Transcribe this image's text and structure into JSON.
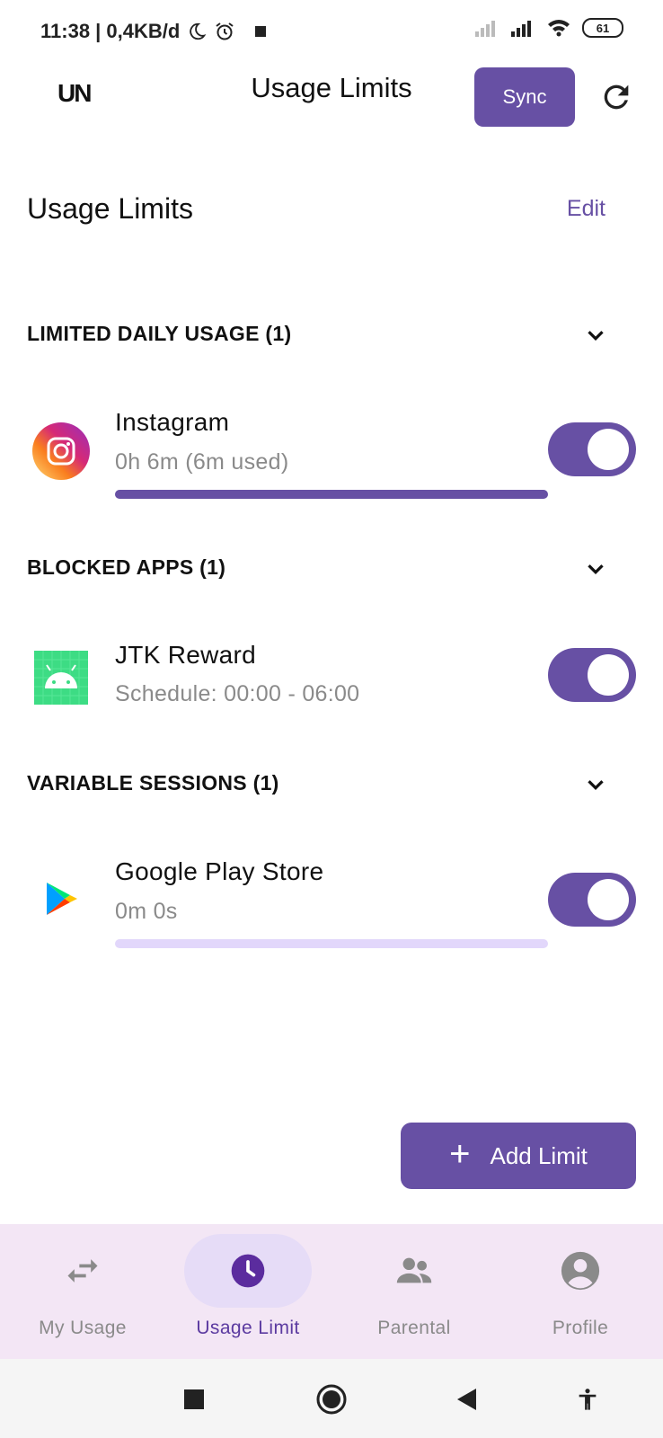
{
  "status_bar": {
    "time_info": "11:38 | 0,4KB/d",
    "battery": "61"
  },
  "app_bar": {
    "logo": "UN",
    "title": "Usage Limits",
    "sync_label": "Sync"
  },
  "page": {
    "header": "Usage Limits",
    "edit_label": "Edit"
  },
  "groups": [
    {
      "title": "LIMITED DAILY USAGE (1)",
      "app": {
        "name": "Instagram",
        "subtitle": "0h 6m (6m used)",
        "progress": 1.0,
        "enabled": true
      }
    },
    {
      "title": "BLOCKED APPS (1)",
      "app": {
        "name": "JTK Reward",
        "subtitle": "Schedule:  00:00 - 06:00",
        "enabled": true
      }
    },
    {
      "title": "VARIABLE SESSIONS (1)",
      "app": {
        "name": "Google Play Store",
        "subtitle": "0m 0s",
        "progress": 0.0,
        "enabled": true
      }
    }
  ],
  "fab": {
    "label": "Add Limit"
  },
  "bottom_nav": {
    "items": [
      {
        "label": "My Usage",
        "icon": "swap-arrows-icon"
      },
      {
        "label": "Usage Limit",
        "icon": "clock-icon",
        "active": true
      },
      {
        "label": "Parental",
        "icon": "group-icon"
      },
      {
        "label": "Profile",
        "icon": "account-circle-icon"
      }
    ]
  },
  "colors": {
    "accent": "#6750a4",
    "progress_empty": "#e2d7fb",
    "nav_background": "#f3e6f5"
  }
}
